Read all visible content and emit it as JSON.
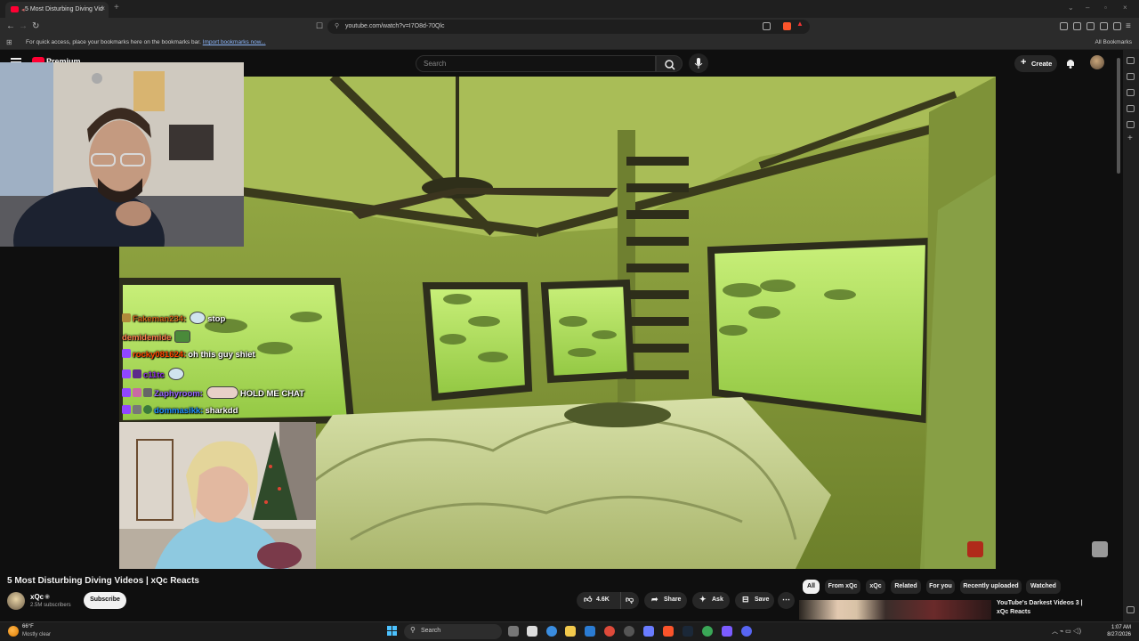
{
  "browser": {
    "tab_title": "5 Most Disturbing Diving Vid",
    "url": "youtube.com/watch?v=I7O8d-70Qlc",
    "bookmarks_message": "For quick access, place your bookmarks here on the bookmarks bar.",
    "bookmarks_import": "Import bookmarks now...",
    "all_bookmarks": "All Bookmarks"
  },
  "youtube": {
    "logo_text": "Premium",
    "search_placeholder": "Search",
    "create_label": "Create"
  },
  "chat": [
    {
      "user": "Fakeman234:",
      "message": "stop",
      "color": "#d2691e"
    },
    {
      "user": "demidemide",
      "message": "",
      "color": "#ff7f50"
    },
    {
      "user": "rocky081624:",
      "message": "oh this guy shiet",
      "color": "#ff4500"
    },
    {
      "user": "c11tc",
      "message": "",
      "color": "#8a2be2"
    },
    {
      "user": "Zaphyroom:",
      "message": "HOLD ME CHAT",
      "color": "#9966ff"
    },
    {
      "user": "dommasikk:",
      "message": "sharkdd",
      "color": "#1e90ff"
    }
  ],
  "video": {
    "title": "5 Most Disturbing Diving Videos | xQc Reacts",
    "channel": "xQc",
    "subscribers": "2.5M subscribers",
    "subscribe_label": "Subscribe",
    "likes": "4.6K",
    "share_label": "Share",
    "ask_label": "Ask",
    "save_label": "Save"
  },
  "chips": [
    "All",
    "From xQc",
    "xQc",
    "Related",
    "For you",
    "Recently uploaded",
    "Watched"
  ],
  "recommended": {
    "title": "YouTube's Darkest Videos 3 | xQc Reacts"
  },
  "taskbar": {
    "temp": "66°F",
    "weather": "Mostly clear",
    "search_label": "Search",
    "time": "1:07 AM",
    "date": "8/27/2026"
  },
  "colors": {
    "youtube_red": "#ff0033",
    "video_tint": "#8fbf3a"
  }
}
